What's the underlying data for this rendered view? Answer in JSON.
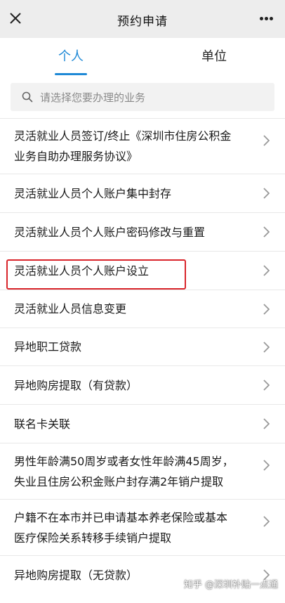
{
  "header": {
    "title": "预约申请",
    "close_icon": "close-icon",
    "more_icon": "more-icon"
  },
  "tabs": [
    {
      "label": "个人",
      "active": true
    },
    {
      "label": "单位",
      "active": false
    }
  ],
  "search": {
    "placeholder": "请选择您要办理的业务",
    "icon": "search-icon"
  },
  "items": [
    {
      "line1": "灵活就业人员签订/终止《深圳市住房公积金",
      "line2": "业务自助办理服务协议》"
    },
    {
      "line1": "灵活就业人员个人账户集中封存"
    },
    {
      "line1": "灵活就业人员个人账户密码修改与重置"
    },
    {
      "line1": "灵活就业人员个人账户设立",
      "highlighted": true
    },
    {
      "line1": "灵活就业人员信息变更"
    },
    {
      "line1": "异地职工贷款"
    },
    {
      "line1": "异地购房提取（有贷款）"
    },
    {
      "line1": "联名卡关联"
    },
    {
      "line1": "男性年龄满50周岁或者女性年龄满45周岁，",
      "line2": "失业且住房公积金账户封存满2年销户提取"
    },
    {
      "line1": "户籍不在本市并已申请基本养老保险或基本",
      "line2": "医疗保险关系转移手续销户提取"
    },
    {
      "line1": "异地购房提取（无贷款）"
    }
  ],
  "watermark": "知乎 @深圳补贴一点通",
  "colors": {
    "accent": "#1e89d6",
    "highlight_border": "#d9252b",
    "header_bg": "#ededed"
  }
}
